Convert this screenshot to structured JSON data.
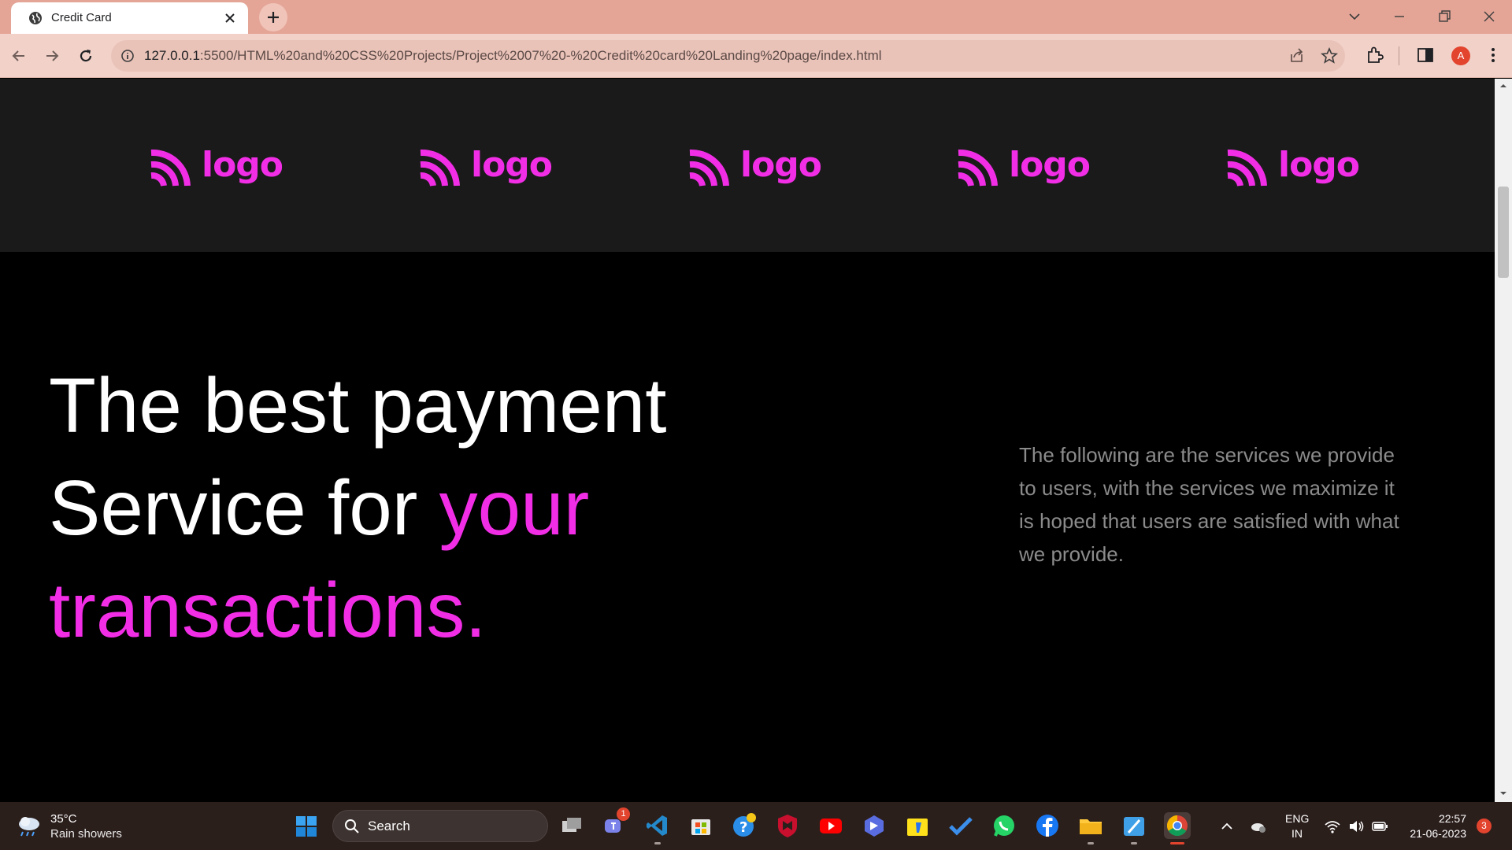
{
  "browser": {
    "tab_title": "Credit Card",
    "url_host": "127.0.0.1",
    "url_path": ":5500/HTML%20and%20CSS%20Projects/Project%2007%20-%20Credit%20card%20Landing%20page/index.html",
    "profile_initial": "A"
  },
  "page": {
    "logos": [
      {
        "label": "logo"
      },
      {
        "label": "logo"
      },
      {
        "label": "logo"
      },
      {
        "label": "logo"
      },
      {
        "label": "logo"
      }
    ],
    "hero": {
      "title_line1": "The best payment",
      "title_line2_white": "Service for ",
      "title_line2_accent": "your",
      "title_line3_accent": "transactions.",
      "description": "The following are the services we provide to users, with the services we maximize it is hoped that users are satisfied with what we provide."
    },
    "colors": {
      "accent": "#f12ee6",
      "strip_bg": "#1a1a1a",
      "page_bg": "#000000",
      "description_text": "#8b8b8b"
    }
  },
  "taskbar": {
    "weather_temp": "35°C",
    "weather_desc": "Rain showers",
    "search_label": "Search",
    "teams_badge": "1",
    "language_line1": "ENG",
    "language_line2": "IN",
    "time": "22:57",
    "date": "21-06-2023",
    "notification_count": "3",
    "apps": [
      "task-view-icon",
      "teams-icon",
      "vscode-icon",
      "store-icon",
      "help-icon",
      "mcafee-icon",
      "youtube-icon",
      "copilot-icon",
      "flipkart-icon",
      "todo-icon",
      "whatsapp-icon",
      "facebook-icon",
      "file-explorer-icon",
      "paint-icon",
      "chrome-icon"
    ]
  }
}
